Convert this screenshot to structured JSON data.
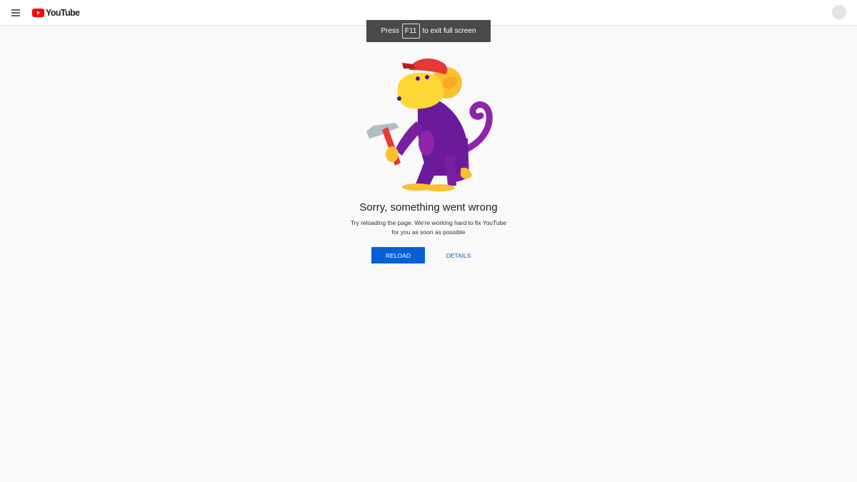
{
  "header": {
    "logo_text": "YouTube",
    "menu_icon": "hamburger-menu-icon",
    "logo_icon": "youtube-play-icon",
    "avatar": "account-avatar",
    "brand_color": "#ff0000"
  },
  "fullscreen_notice": {
    "prefix": "Press",
    "key": "F11",
    "suffix": "to exit full screen"
  },
  "error": {
    "illustration": "monkey-with-hammer",
    "title": "Sorry, something went wrong",
    "description_line1": "Try reloading the page. We're working hard to fix YouTube",
    "description_line2": "for you as soon as possible",
    "reload_label": "RELOAD",
    "details_label": "DETAILS",
    "accent_color": "#065fd4"
  }
}
